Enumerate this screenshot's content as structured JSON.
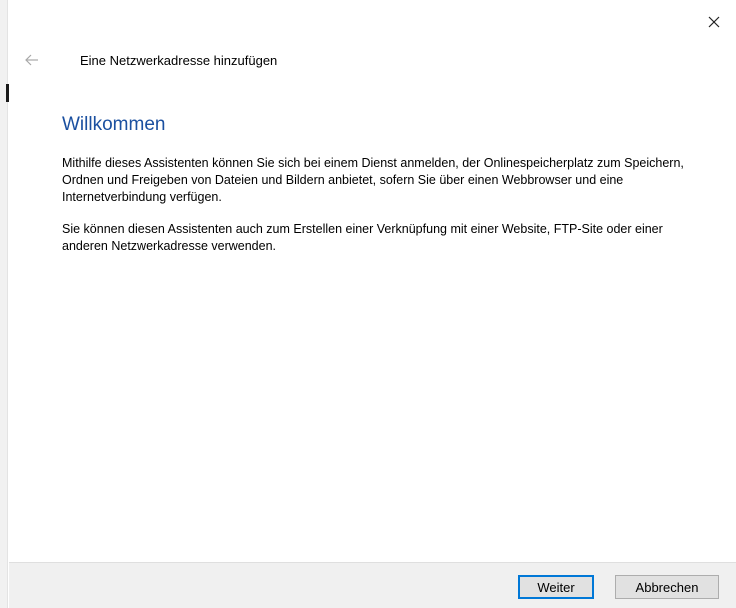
{
  "window": {
    "title": "Eine Netzwerkadresse hinzufügen",
    "close_icon": "close-icon",
    "back_icon": "back-arrow-icon"
  },
  "main": {
    "heading": "Willkommen",
    "paragraphs": [
      "Mithilfe dieses Assistenten können Sie sich bei einem Dienst anmelden, der Onlinespeicherplatz zum Speichern, Ordnen und Freigeben von Dateien und Bildern anbietet, sofern Sie über einen Webbrowser und eine Internetverbindung verfügen.",
      "Sie können diesen Assistenten auch zum Erstellen einer Verknüpfung mit einer Website, FTP-Site oder einer anderen Netzwerkadresse verwenden."
    ]
  },
  "footer": {
    "next_label": "Weiter",
    "cancel_label": "Abbrechen"
  },
  "colors": {
    "heading": "#1b50a0",
    "primary_border": "#0078d7",
    "footer_bg": "#f0f0f0"
  }
}
